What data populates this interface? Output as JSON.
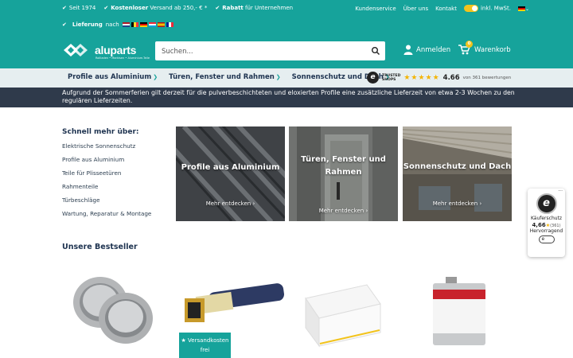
{
  "topbar": {
    "items": [
      {
        "plain_prefix": "Seit 1974",
        "bold": "",
        "rest": ""
      },
      {
        "plain_prefix": "",
        "bold": "Kostenloser",
        "rest": " Versand ab 250,- € *"
      },
      {
        "plain_prefix": "",
        "bold": "Rabatt",
        "rest": " für Unternehmen"
      }
    ],
    "delivery_bold": "Lieferung",
    "delivery_rest": "nach",
    "links": [
      "Kundenservice",
      "Über uns",
      "Kontakt"
    ],
    "vat_label": "inkl. MwSt."
  },
  "header": {
    "logo_text": "aluparts",
    "logo_sub": "Rollladen • Markisen • Aluminium-Teile",
    "search_placeholder": "Suchen...",
    "login_label": "Anmelden",
    "cart_label": "Warenkorb",
    "cart_count": "0"
  },
  "nav": {
    "items": [
      "Profile aus Aluminium",
      "Türen, Fenster und Rahmen",
      "Sonnenschutz und Dach"
    ],
    "trusted_line1": "TRUSTED",
    "trusted_line2": "SHOPS",
    "stars": "★★★★★",
    "rating": "4.66",
    "reviews": "von 361 bewertungen"
  },
  "notice": "Aufgrund der Sommerferien gilt derzeit für die pulverbeschichteten und eloxierten Profile eine zusätzliche Lieferzeit von etwa 2-3 Wochen zu den regulären Lieferzeiten.",
  "sidebar": {
    "title": "Schnell mehr über:",
    "links": [
      "Elektrische Sonnenschutz",
      "Profile aus Aluminium",
      "Teile für Plisseetüren",
      "Rahmenteile",
      "Türbeschläge",
      "Wartung, Reparatur & Montage"
    ]
  },
  "cards": [
    {
      "title": "Profile aus Aluminium",
      "more": "Mehr entdecken"
    },
    {
      "title": "Türen, Fenster und Rahmen",
      "more": "Mehr entdecken"
    },
    {
      "title": "Sonnenschutz und Dach",
      "more": "Mehr entdecken"
    }
  ],
  "trust_widget": {
    "label": "Käuferschutz",
    "rating": "4,66",
    "count": "(361)",
    "verdict": "Hervorragend"
  },
  "bestseller": {
    "title": "Unsere Bestseller",
    "badge_line1": "Versandkosten",
    "badge_line2": "frei"
  },
  "colors": {
    "teal": "#16a39b",
    "navy": "#2f3a4b",
    "accent_yellow": "#f2c31c"
  }
}
